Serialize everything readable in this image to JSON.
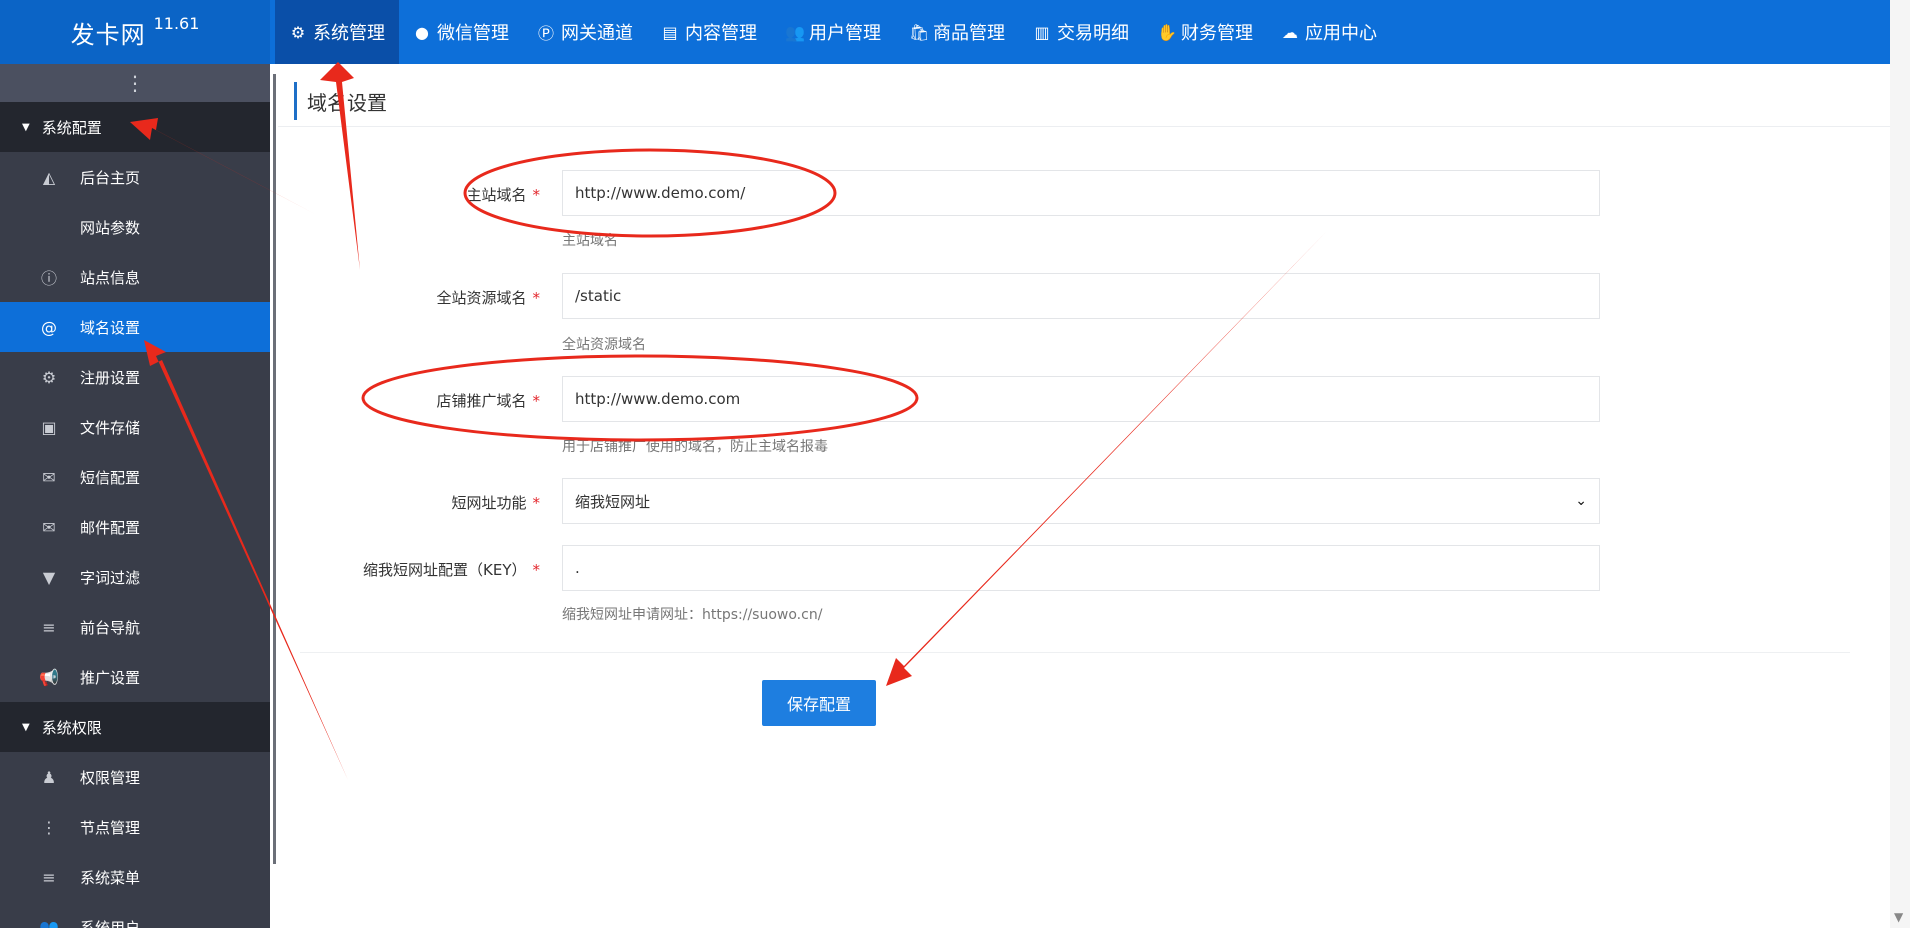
{
  "brand": {
    "name": "发卡网",
    "version": "11.61"
  },
  "topnav": [
    {
      "icon": "gear-icon",
      "glyph": "⚙",
      "label": "系统管理",
      "active": true
    },
    {
      "icon": "wechat-icon",
      "glyph": "●",
      "label": "微信管理"
    },
    {
      "icon": "gateway-icon",
      "glyph": "Ⓟ",
      "label": "网关通道"
    },
    {
      "icon": "document-icon",
      "glyph": "▤",
      "label": "内容管理"
    },
    {
      "icon": "users-icon",
      "glyph": "👥",
      "label": "用户管理"
    },
    {
      "icon": "shopping-bag-icon",
      "glyph": "🛍",
      "label": "商品管理"
    },
    {
      "icon": "bar-chart-icon",
      "glyph": "▥",
      "label": "交易明细"
    },
    {
      "icon": "finance-icon",
      "glyph": "✋",
      "label": "财务管理"
    },
    {
      "icon": "cloud-icon",
      "glyph": "☁",
      "label": "应用中心"
    }
  ],
  "sidebar": {
    "toggle_glyph": "⋮",
    "group1": "系统配置",
    "group1_items": [
      {
        "icon": "area-chart-icon",
        "glyph": "◭",
        "label": "后台主页"
      },
      {
        "icon": "apple-icon",
        "glyph": "",
        "label": "网站参数"
      },
      {
        "icon": "info-icon",
        "glyph": "ⓘ",
        "label": "站点信息"
      },
      {
        "icon": "at-icon",
        "glyph": "@",
        "label": "域名设置",
        "active": true
      },
      {
        "icon": "gear-icon",
        "glyph": "⚙",
        "label": "注册设置"
      },
      {
        "icon": "floppy-disk-icon",
        "glyph": "▣",
        "label": "文件存储"
      },
      {
        "icon": "envelope-icon",
        "glyph": "✉",
        "label": "短信配置"
      },
      {
        "icon": "envelope-icon",
        "glyph": "✉",
        "label": "邮件配置"
      },
      {
        "icon": "filter-icon",
        "glyph": "▼",
        "label": "字词过滤"
      },
      {
        "icon": "bars-icon",
        "glyph": "≡",
        "label": "前台导航"
      },
      {
        "icon": "bullhorn-icon",
        "glyph": "📢",
        "label": "推广设置"
      }
    ],
    "group2": "系统权限",
    "group2_items": [
      {
        "icon": "user-secret-icon",
        "glyph": "♟",
        "label": "权限管理"
      },
      {
        "icon": "ellipsis-vertical-icon",
        "glyph": "⋮",
        "label": "节点管理"
      },
      {
        "icon": "bars-icon",
        "glyph": "≡",
        "label": "系统菜单"
      },
      {
        "icon": "users-icon",
        "glyph": "👥",
        "label": "系统用户"
      }
    ]
  },
  "page": {
    "title": "域名设置"
  },
  "form": {
    "main_domain": {
      "label": "主站域名",
      "value": "http://www.demo.com/",
      "help": "主站域名"
    },
    "static_domain": {
      "label": "全站资源域名",
      "value": "/static",
      "help": "全站资源域名"
    },
    "shop_domain": {
      "label": "店铺推广域名",
      "value": "http://www.demo.com",
      "help": "用于店铺推广使用的域名，防止主域名报毒"
    },
    "short_url": {
      "label": "短网址功能",
      "selected": "缩我短网址"
    },
    "short_key": {
      "label": "缩我短网址配置（KEY）",
      "value": ".",
      "help": "缩我短网址申请网址：https://suowo.cn/"
    },
    "required_mark": "*",
    "save_label": "保存配置"
  },
  "colors": {
    "topbar": "#0d6fd9",
    "sidebar": "#393d49",
    "active": "#0d6fd9",
    "button": "#1e7ee0",
    "annotation": "#e8291c"
  }
}
